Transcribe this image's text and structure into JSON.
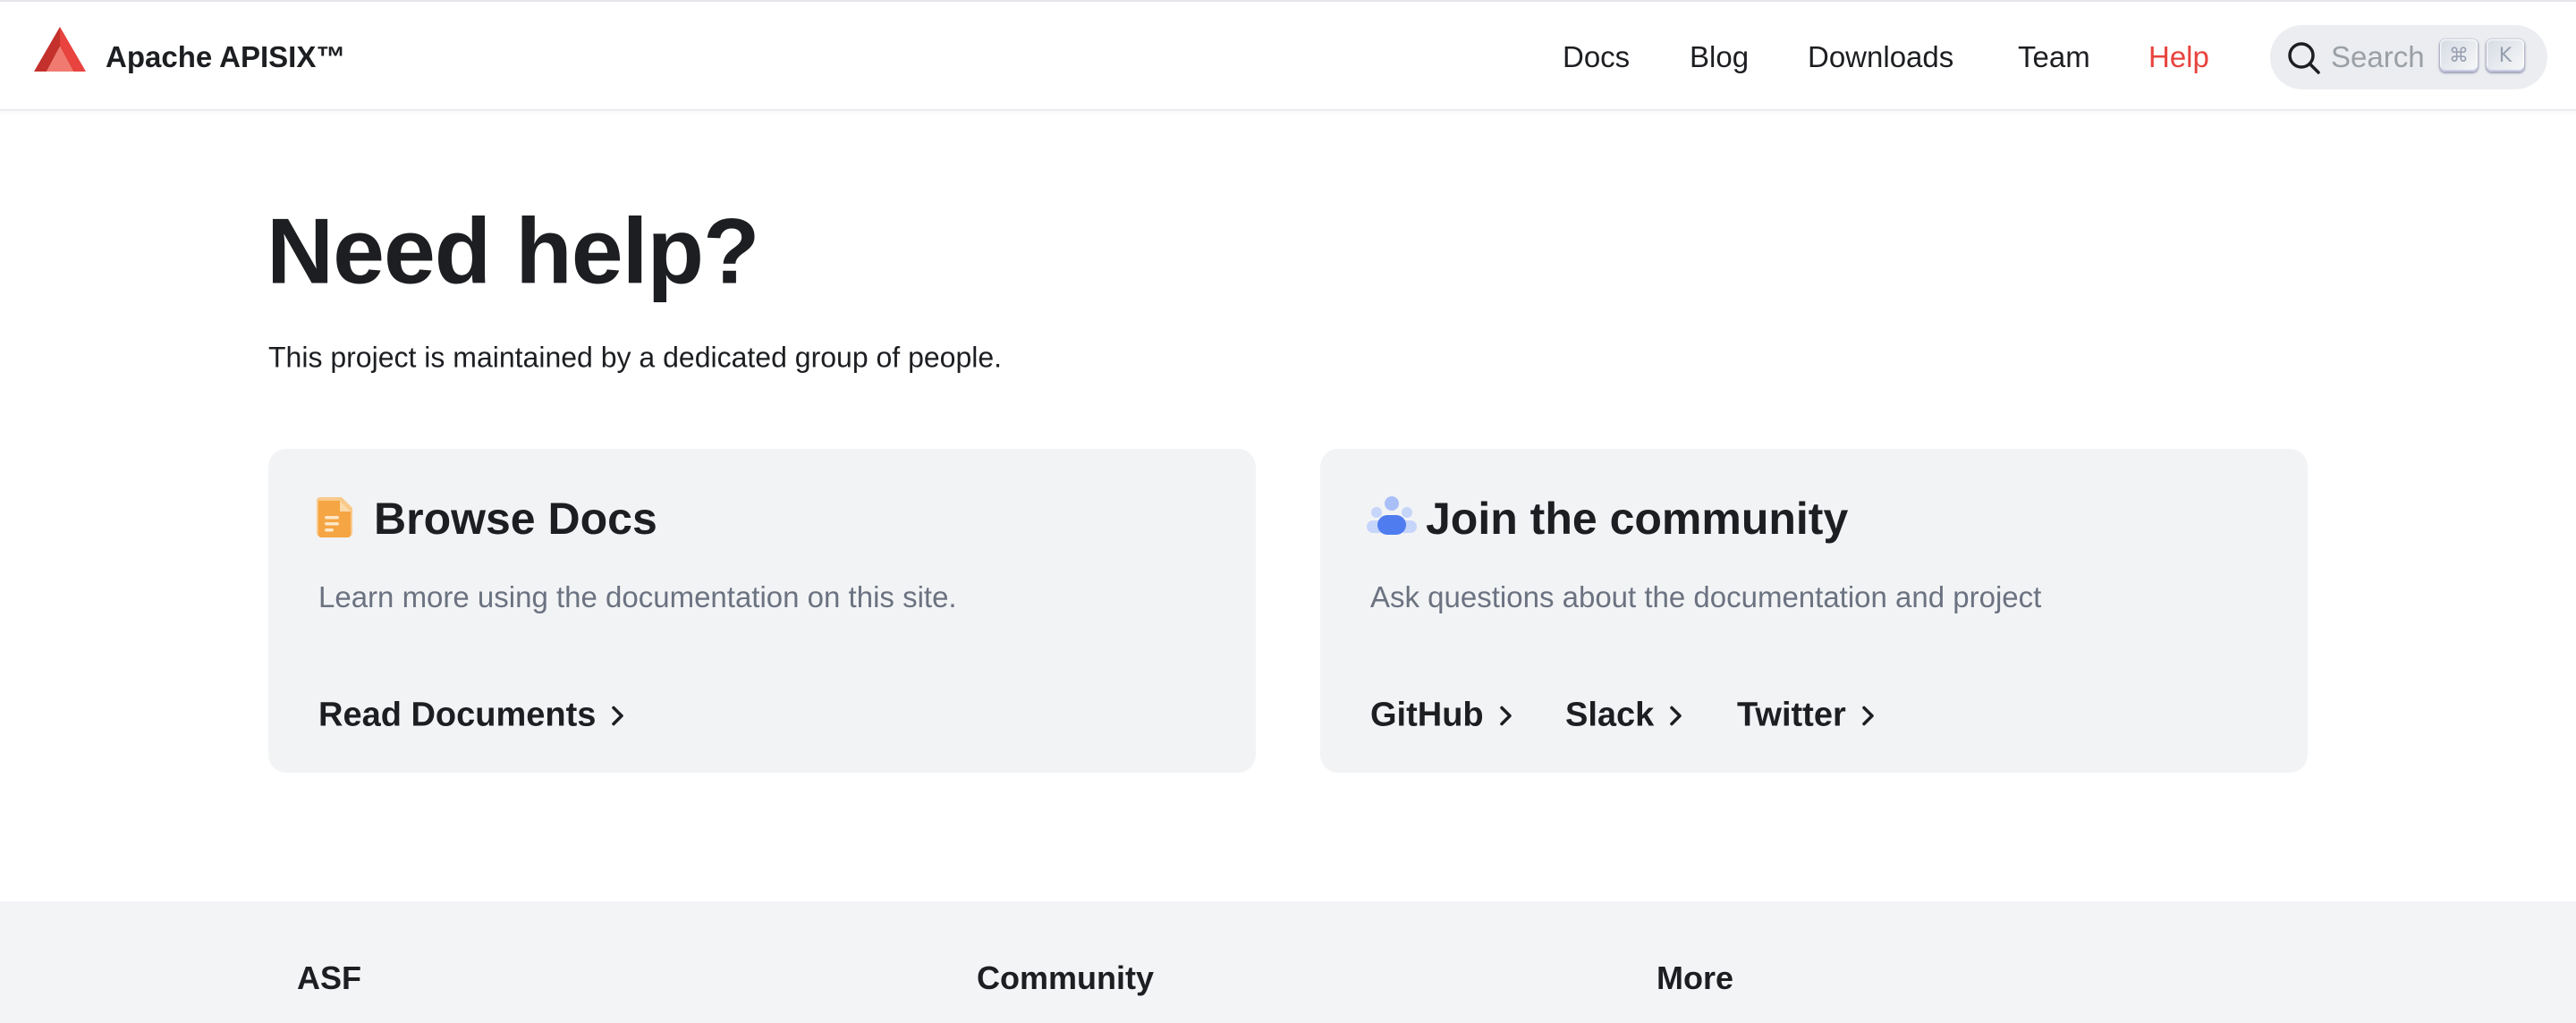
{
  "navbar": {
    "brand_title": "Apache APISIX™",
    "links": [
      "Docs",
      "Blog",
      "Downloads",
      "Team",
      "Help"
    ],
    "active_link": "Help",
    "search": {
      "placeholder": "Search",
      "shortcut_keys": [
        "⌘",
        "K"
      ]
    }
  },
  "hero": {
    "title": "Need help?",
    "subtitle": "This project is maintained by a dedicated group of people."
  },
  "cards": [
    {
      "icon": "document-icon",
      "title": "Browse Docs",
      "description": "Learn more using the documentation on this site.",
      "links": [
        "Read Documents"
      ]
    },
    {
      "icon": "community-icon",
      "title": "Join the community",
      "description": "Ask questions about the documentation and project",
      "links": [
        "GitHub",
        "Slack",
        "Twitter"
      ]
    }
  ],
  "footer": {
    "columns": [
      "ASF",
      "Community",
      "More"
    ]
  },
  "colors": {
    "brand_red": "#e8433e",
    "text": "#1c1e21",
    "muted_text": "#6b7280",
    "card_background": "#f2f3f5",
    "footer_background": "#f3f4f6",
    "doc_icon_orange": "#f5a543",
    "community_icon_blue": "#4f7df0"
  }
}
